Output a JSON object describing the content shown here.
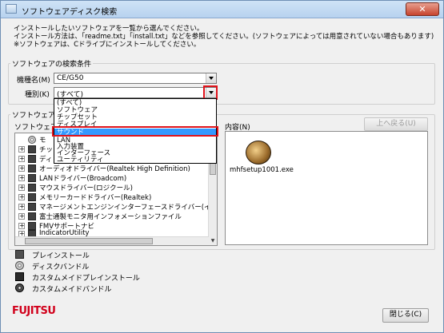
{
  "window": {
    "title": "ソフトウェアディスク検索",
    "close_glyph": "✕"
  },
  "intro_lines": [
    "インストールしたいソフトウェアを一覧から選んでください。",
    "インストール方法は、「readme.txt」「install.txt」などを参照してください。(ソフトウェアによっては用意されていない場合もあります)",
    "※ソフトウェアは、Cドライブにインストールしてください。"
  ],
  "search_conditions": {
    "legend": "ソフトウェアの検索条件",
    "model_label": "機種名(M)",
    "model_value": "CE/G50",
    "type_label": "種別(K)",
    "type_value": "(すべて)"
  },
  "type_dropdown": {
    "options": [
      "(すべて)",
      "ソフトウェア",
      "チップセット",
      "ディスプレイ",
      "サウンド",
      "LAN",
      "入力装置",
      "インターフェース",
      "ユーティリティ"
    ],
    "selected_index": 4
  },
  "software_list": {
    "group_legend": "ソフトウェア",
    "list_label": "ソフトウェア(",
    "items": [
      {
        "text": "モ",
        "expand": "",
        "icon": "disc-icon"
      },
      {
        "text": "チッ",
        "expand": "+",
        "icon": "book-icon"
      },
      {
        "text": "ディ",
        "expand": "+",
        "icon": "book-icon"
      },
      {
        "text": "オーディオドライバー(Realtek High Definition)",
        "expand": "+",
        "icon": "book-icon"
      },
      {
        "text": "LANドライバー(Broadcom)",
        "expand": "+",
        "icon": "book-icon"
      },
      {
        "text": "マウスドライバー(ロジクール)",
        "expand": "+",
        "icon": "book-icon"
      },
      {
        "text": "メモリーカードドライバー(Realtek)",
        "expand": "+",
        "icon": "book-icon"
      },
      {
        "text": "マネージメントエンジンインターフェースドライバー(インテ",
        "expand": "+",
        "icon": "book-icon"
      },
      {
        "text": "富士通製モニタ用インフォメーションファイル",
        "expand": "+",
        "icon": "book-icon"
      },
      {
        "text": "FMVサポートナビ",
        "expand": "+",
        "icon": "book-icon"
      },
      {
        "text": "IndicatorUtility",
        "expand": "+",
        "icon": "book-icon"
      }
    ]
  },
  "contents": {
    "label": "内容(N)",
    "up_button": "上へ戻る(U)",
    "file_name": "mhfsetup1001.exe"
  },
  "legend_items": [
    {
      "icon": "book-icon",
      "label": "プレインストール"
    },
    {
      "icon": "disc-icon",
      "label": "ディスクバンドル"
    },
    {
      "icon": "book-dark-icon",
      "label": "カスタムメイドプレインストール"
    },
    {
      "icon": "disc-dark-icon",
      "label": "カスタムメイドバンドル"
    }
  ],
  "footer": {
    "logo": "FUJITSU",
    "close_button": "閉じる(C)"
  },
  "colors": {
    "highlight": "#3399ff",
    "annotation_red": "#e0121a",
    "logo_red": "#d1001b"
  }
}
